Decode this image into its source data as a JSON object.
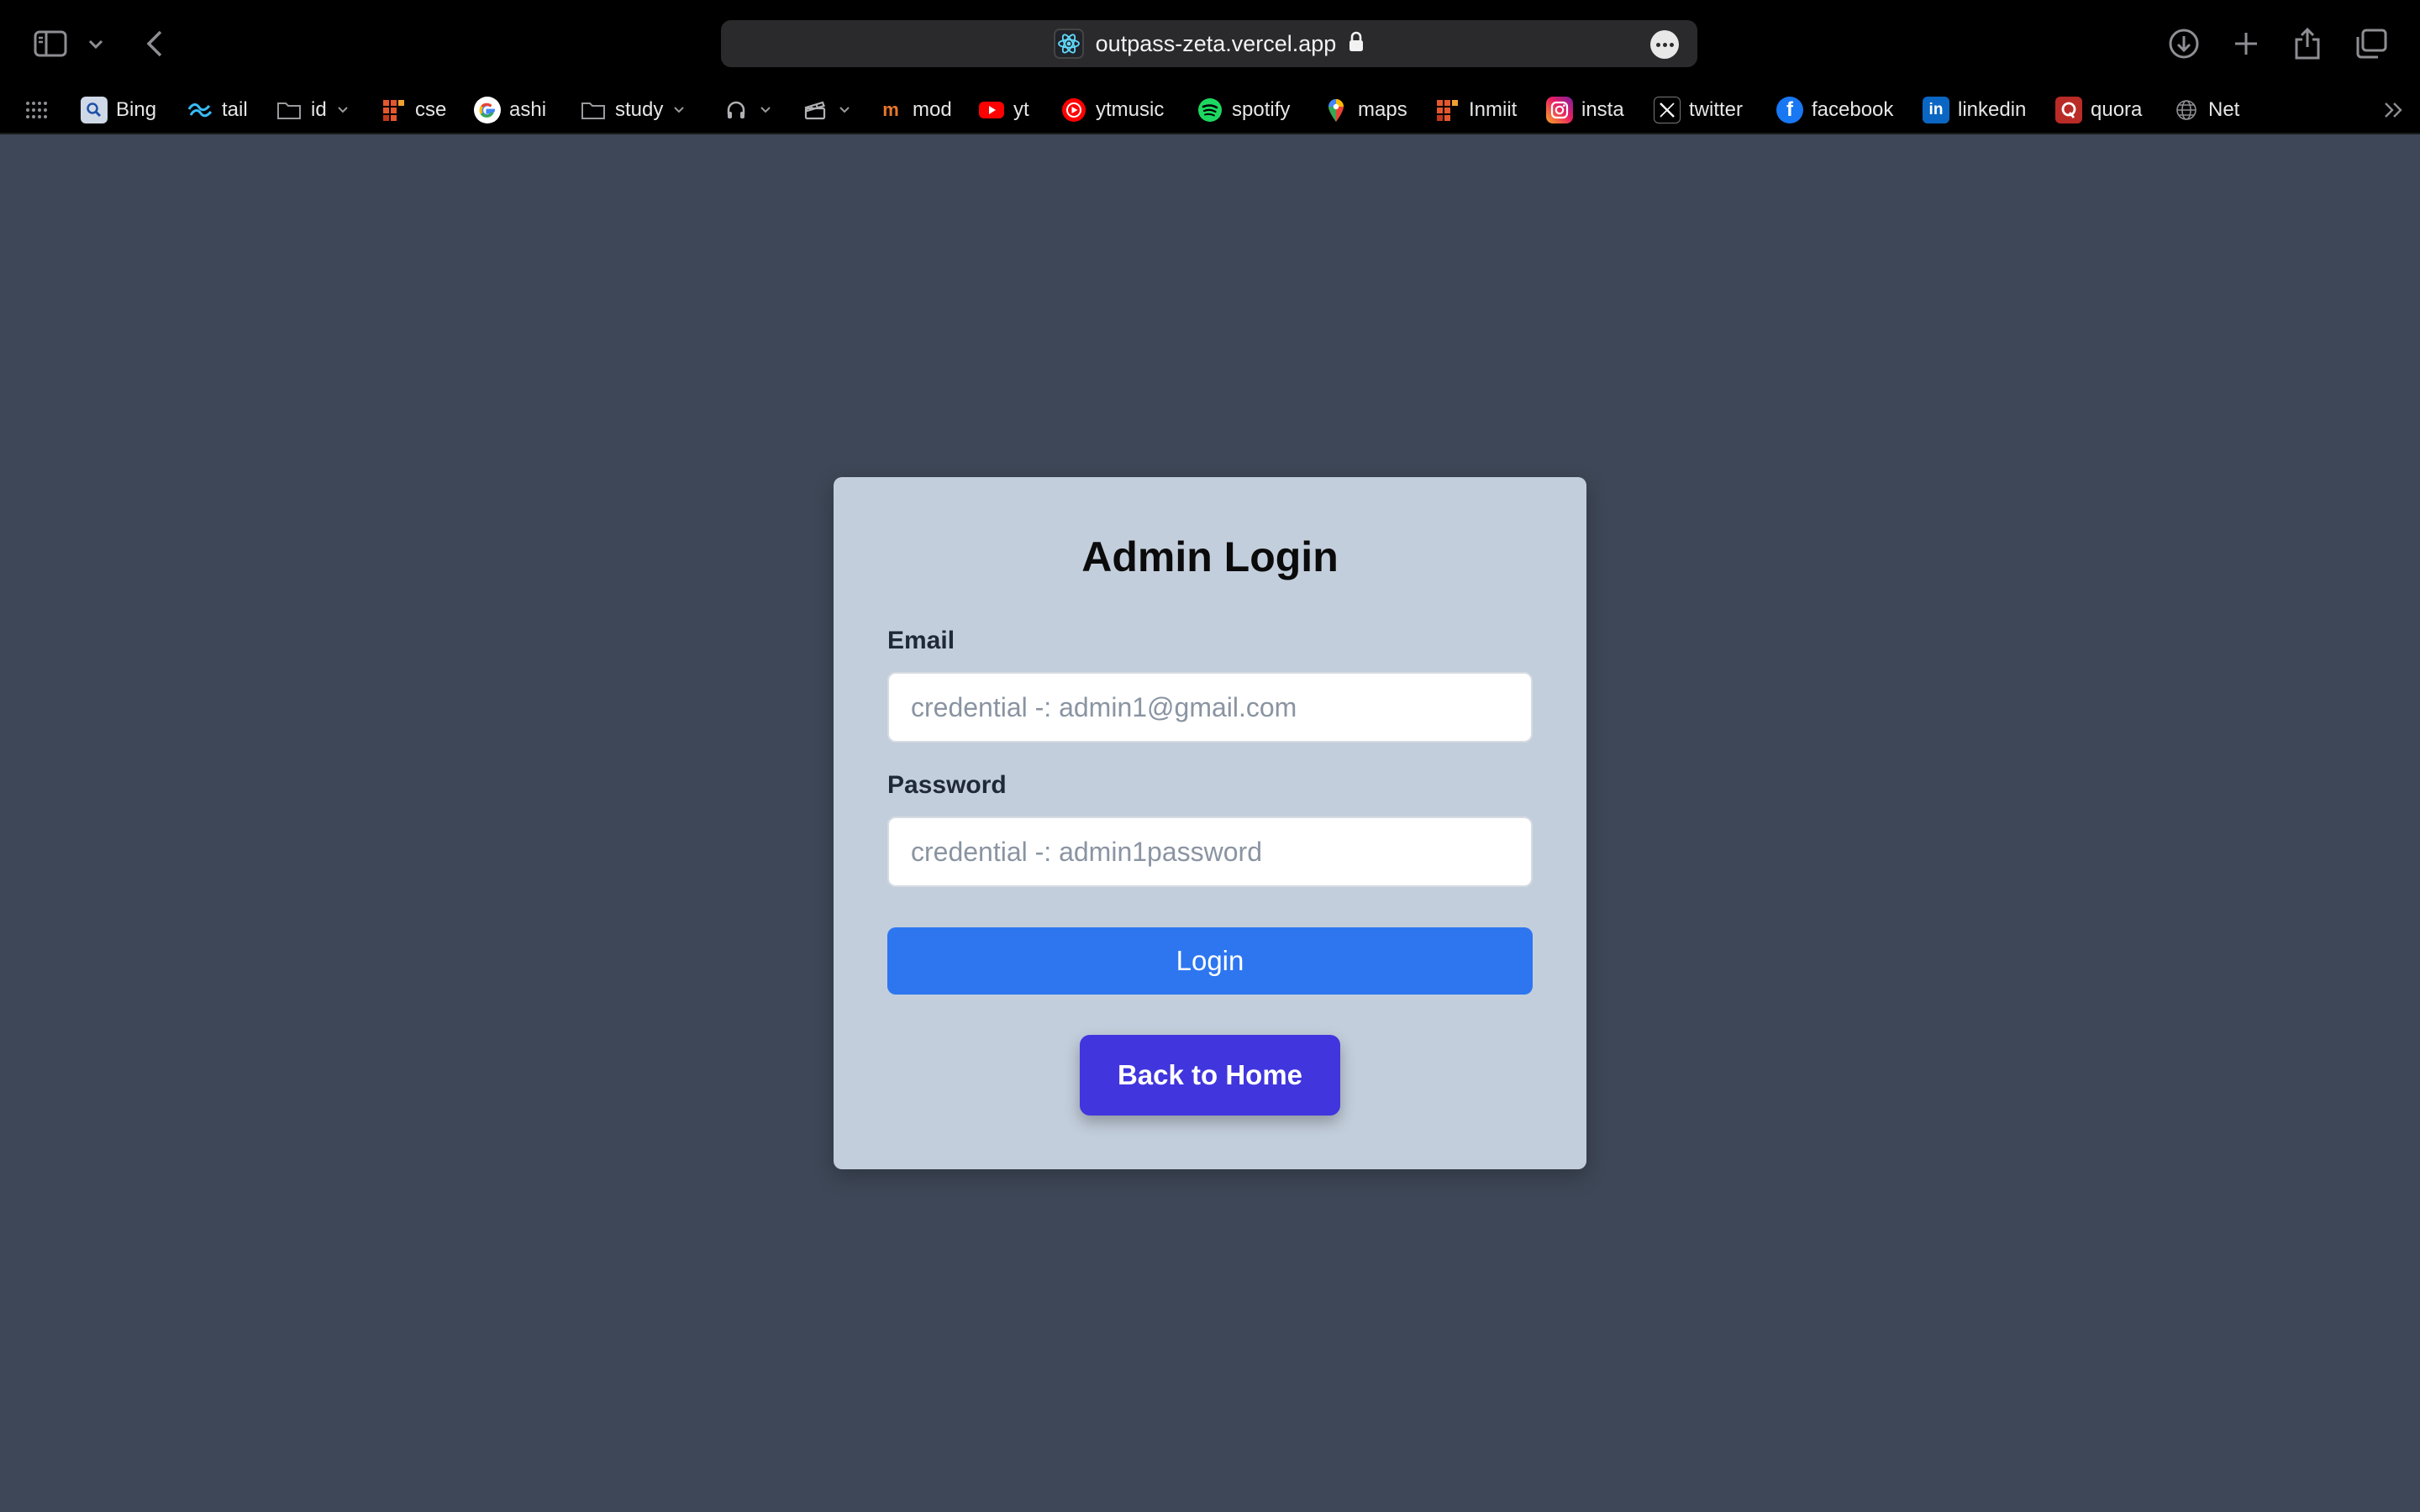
{
  "browser": {
    "url": "outpass-zeta.vercel.app"
  },
  "favorites": [
    {
      "label": "Bing",
      "icon": "bing-icon"
    },
    {
      "label": "tail",
      "icon": "tailwind-icon"
    },
    {
      "label": "id",
      "icon": "folder-icon"
    },
    {
      "label": "cse",
      "icon": "grid-logo-icon"
    },
    {
      "label": "ashi",
      "icon": "google-icon"
    },
    {
      "label": "study",
      "icon": "folder-icon"
    },
    {
      "label": "",
      "icon": "headphones-icon"
    },
    {
      "label": "",
      "icon": "clapperboard-icon"
    },
    {
      "label": "mod",
      "icon": "mod-icon"
    },
    {
      "label": "yt",
      "icon": "youtube-icon"
    },
    {
      "label": "ytmusic",
      "icon": "youtube-music-icon"
    },
    {
      "label": "spotify",
      "icon": "spotify-icon"
    },
    {
      "label": "maps",
      "icon": "maps-pin-icon"
    },
    {
      "label": "Inmiit",
      "icon": "grid-logo-icon"
    },
    {
      "label": "insta",
      "icon": "instagram-icon"
    },
    {
      "label": "twitter",
      "icon": "x-icon"
    },
    {
      "label": "facebook",
      "icon": "facebook-icon"
    },
    {
      "label": "linkedin",
      "icon": "linkedin-icon"
    },
    {
      "label": "quora",
      "icon": "quora-icon"
    },
    {
      "label": "Net",
      "icon": "globe-icon"
    }
  ],
  "login": {
    "title": "Admin Login",
    "email_label": "Email",
    "email_value": "",
    "email_placeholder": "credential -: admin1@gmail.com",
    "password_label": "Password",
    "password_value": "",
    "password_placeholder": "credential -: admin1password",
    "login_button": "Login",
    "home_button": "Back to Home"
  },
  "colors": {
    "page_bg": "#3e4757",
    "card_bg": "#c3cedc",
    "login_button": "#2d76f0",
    "home_button": "#4135de"
  }
}
